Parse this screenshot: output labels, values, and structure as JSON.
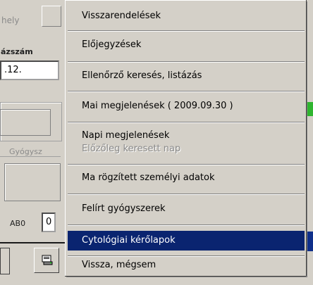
{
  "background": {
    "label_hely": "hely",
    "label_hazszam": "ázszám",
    "date_value": ".12.",
    "label_gyogysz": "Gyógysz",
    "label_ab0": "AB0",
    "ab0_value": "0",
    "accent_green": "#2fb52f"
  },
  "menu": {
    "items": [
      {
        "label": "Visszarendelések"
      },
      {
        "label": "Előjegyzések"
      },
      {
        "label": "Ellenőrző keresés, listázás"
      },
      {
        "label": "Mai megjelenések ( 2009.09.30 )"
      },
      {
        "label": "Napi megjelenések"
      },
      {
        "label": "Előzőleg keresett nap",
        "disabled": true
      },
      {
        "label": "Ma rögzített személyi adatok"
      },
      {
        "label": "Felírt gyógyszerek"
      },
      {
        "label": "Cytológiai kérőlapok",
        "selected": true
      },
      {
        "label": "Vissza, mégsem"
      }
    ],
    "selection_color": "#0a2470"
  },
  "icons": {
    "toolbar_button": "printer-icon"
  }
}
